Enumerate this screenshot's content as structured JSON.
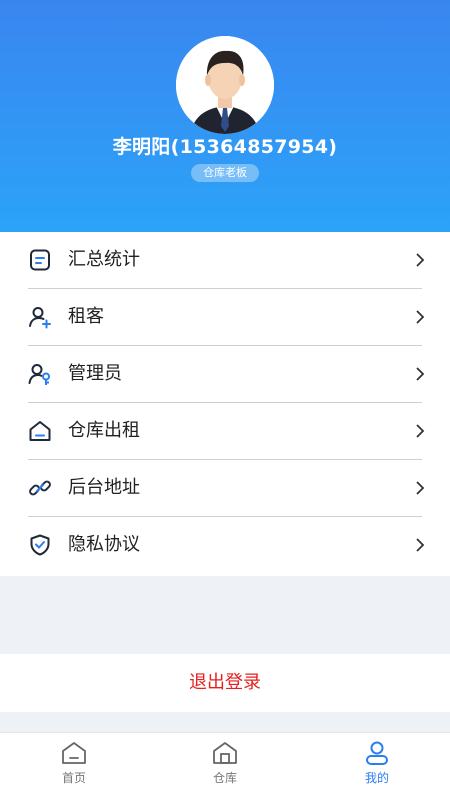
{
  "profile": {
    "name_phone": "李明阳(15364857954)",
    "role": "仓库老板",
    "avatar_icon": "user-avatar"
  },
  "menu": {
    "items": [
      {
        "label": "汇总统计",
        "icon": "summary-icon"
      },
      {
        "label": "租客",
        "icon": "add-user-icon"
      },
      {
        "label": "管理员",
        "icon": "admin-key-icon"
      },
      {
        "label": "仓库出租",
        "icon": "warehouse-icon"
      },
      {
        "label": "后台地址",
        "icon": "link-icon"
      },
      {
        "label": "隐私协议",
        "icon": "shield-check-icon"
      }
    ]
  },
  "logout": {
    "label": "退出登录"
  },
  "tabbar": {
    "items": [
      {
        "label": "首页",
        "icon": "home-icon"
      },
      {
        "label": "仓库",
        "icon": "warehouse-icon"
      },
      {
        "label": "我的",
        "icon": "profile-icon"
      }
    ],
    "active_color": "#2b7ef0"
  },
  "colors": {
    "header_gradient_top": "#3a86f0",
    "header_gradient_bottom": "#2ba3f8",
    "logout_text": "#e3211f"
  }
}
